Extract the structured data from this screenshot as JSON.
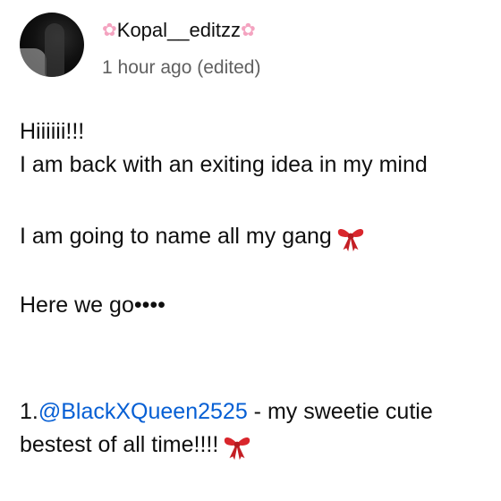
{
  "comment": {
    "author_prefix_icon": "cherry-blossom",
    "author_name": "Kopal__editzz",
    "author_suffix_icon": "cherry-blossom",
    "timestamp": "1 hour ago (edited)",
    "lines": {
      "l1": "Hiiiiii!!!",
      "l2": "I am back with an exiting idea in my mind",
      "l3": "I am going to name all my gang",
      "l4": "Here we go••••",
      "l5_prefix": "1.",
      "l5_mention": "@BlackXQueen2525",
      "l5_suffix": " - my sweetie cutie",
      "l6": "bestest of all time!!!!"
    },
    "emoji": "ribbon",
    "colors": {
      "text": "#0f0f0f",
      "meta": "#606060",
      "mention": "#065fd4",
      "ribbon": "#d9262c",
      "blossom": "#f4a3c0"
    }
  }
}
